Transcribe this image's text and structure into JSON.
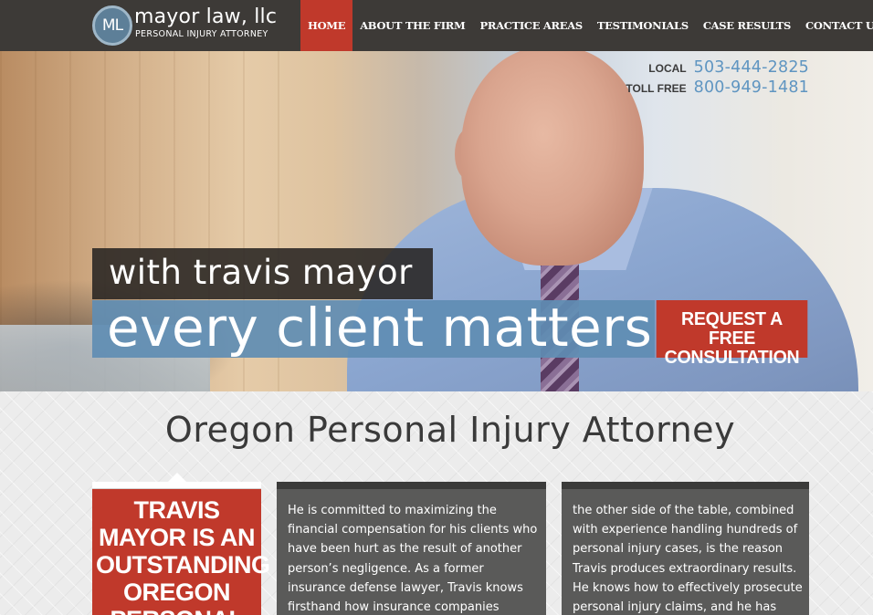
{
  "header": {
    "logo_initials": "ML",
    "logo_name": "mayor law, llc",
    "logo_tagline": "PERSONAL INJURY ATTORNEY",
    "nav": [
      {
        "label": "HOME",
        "active": true
      },
      {
        "label": "ABOUT THE FIRM",
        "active": false
      },
      {
        "label": "PRACTICE AREAS",
        "active": false
      },
      {
        "label": "TESTIMONIALS",
        "active": false
      },
      {
        "label": "CASE RESULTS",
        "active": false
      },
      {
        "label": "CONTACT US",
        "active": false
      }
    ]
  },
  "hero": {
    "phones": [
      {
        "label": "LOCAL",
        "number": "503-444-2825"
      },
      {
        "label": "TOLL FREE",
        "number": "800-949-1481"
      }
    ],
    "tagline_small": "with travis mayor",
    "tagline_big": "every client matters",
    "cta_line1": "REQUEST A FREE",
    "cta_line2": "CONSULTATION"
  },
  "main": {
    "title": "Oregon Personal Injury Attorney",
    "promo_text": "TRAVIS MAYOR IS AN OUTSTANDING OREGON PERSONAL",
    "card1_text": "He is committed to maximizing the financial compensation for his clients who have been hurt as the result of another person’s negligence. As a former insurance defense lawyer, Travis knows firsthand how insurance companies",
    "card2_text": "the other side of the table, combined with experience handling hundreds of personal injury cases, is the reason Travis produces extraordinary results. He knows how to effectively prosecute personal injury claims, and he has"
  },
  "colors": {
    "header_bg": "#3d3a37",
    "accent_red": "#c0392b",
    "accent_blue": "#5f8db3",
    "card_bg": "#5a5a59"
  }
}
